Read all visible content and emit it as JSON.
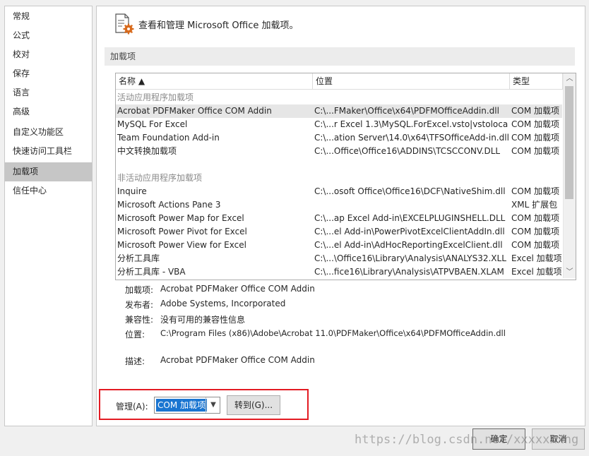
{
  "nav": {
    "items": [
      {
        "label": "常规"
      },
      {
        "label": "公式"
      },
      {
        "label": "校对"
      },
      {
        "label": "保存"
      },
      {
        "label": "语言"
      },
      {
        "label": "高级"
      },
      {
        "label": "自定义功能区"
      },
      {
        "label": "快速访问工具栏"
      },
      {
        "label": "加载项"
      },
      {
        "label": "信任中心"
      }
    ],
    "active": "加载项"
  },
  "header": {
    "icon": "addins-settings-icon",
    "title": "查看和管理 Microsoft Office 加载项。"
  },
  "section": {
    "title": "加载项"
  },
  "grid": {
    "columns": {
      "name": "名称 ▲",
      "location": "位置",
      "type": "类型"
    },
    "active_group": "活动应用程序加载项",
    "active_rows": [
      {
        "name": "Acrobat PDFMaker Office COM Addin",
        "location": "C:\\...FMaker\\Office\\x64\\PDFMOfficeAddin.dll",
        "type": "COM 加载项",
        "selected": true
      },
      {
        "name": "MySQL For Excel",
        "location": "C:\\...r Excel 1.3\\MySQL.ForExcel.vsto|vstolocal",
        "type": "COM 加载项"
      },
      {
        "name": "Team Foundation Add-in",
        "location": "C:\\...ation Server\\14.0\\x64\\TFSOfficeAdd-in.dll",
        "type": "COM 加载项"
      },
      {
        "name": "中文转换加载项",
        "location": "C:\\...Office\\Office16\\ADDINS\\TCSCCONV.DLL",
        "type": "COM 加载项"
      }
    ],
    "inactive_group": "非活动应用程序加载项",
    "inactive_rows": [
      {
        "name": "Inquire",
        "location": "C:\\...osoft Office\\Office16\\DCF\\NativeShim.dll",
        "type": "COM 加载项"
      },
      {
        "name": "Microsoft Actions Pane 3",
        "location": "",
        "type": "XML 扩展包"
      },
      {
        "name": "Microsoft Power Map for Excel",
        "location": "C:\\...ap Excel Add-in\\EXCELPLUGINSHELL.DLL",
        "type": "COM 加载项"
      },
      {
        "name": "Microsoft Power Pivot for Excel",
        "location": "C:\\...el Add-in\\PowerPivotExcelClientAddIn.dll",
        "type": "COM 加载项"
      },
      {
        "name": "Microsoft Power View for Excel",
        "location": "C:\\...el Add-in\\AdHocReportingExcelClient.dll",
        "type": "COM 加载项"
      },
      {
        "name": "分析工具库",
        "location": "C:\\...\\Office16\\Library\\Analysis\\ANALYS32.XLL",
        "type": "Excel 加载项"
      },
      {
        "name": "分析工具库 - VBA",
        "location": "C:\\...fice16\\Library\\Analysis\\ATPVBAEN.XLAM",
        "type": "Excel 加载项"
      }
    ]
  },
  "details": {
    "addin_label": "加载项:",
    "addin": "Acrobat PDFMaker Office COM Addin",
    "publisher_label": "发布者:",
    "publisher": "Adobe Systems, Incorporated",
    "compat_label": "兼容性:",
    "compat": "没有可用的兼容性信息",
    "location_label": "位置:",
    "location": "C:\\Program Files (x86)\\Adobe\\Acrobat 11.0\\PDFMaker\\Office\\x64\\PDFMOfficeAddin.dll",
    "desc_label": "描述:",
    "desc": "Acrobat PDFMaker Office COM Addin"
  },
  "manage": {
    "label": "管理(A):",
    "selected": "COM 加载项",
    "go_button": "转到(G)..."
  },
  "footer": {
    "ok": "确定",
    "cancel": "取消"
  },
  "watermark": "https://blog.csdn.net/xxxxxxxng",
  "colors": {
    "highlight": "#e31b23",
    "selection": "#1a75d1"
  }
}
